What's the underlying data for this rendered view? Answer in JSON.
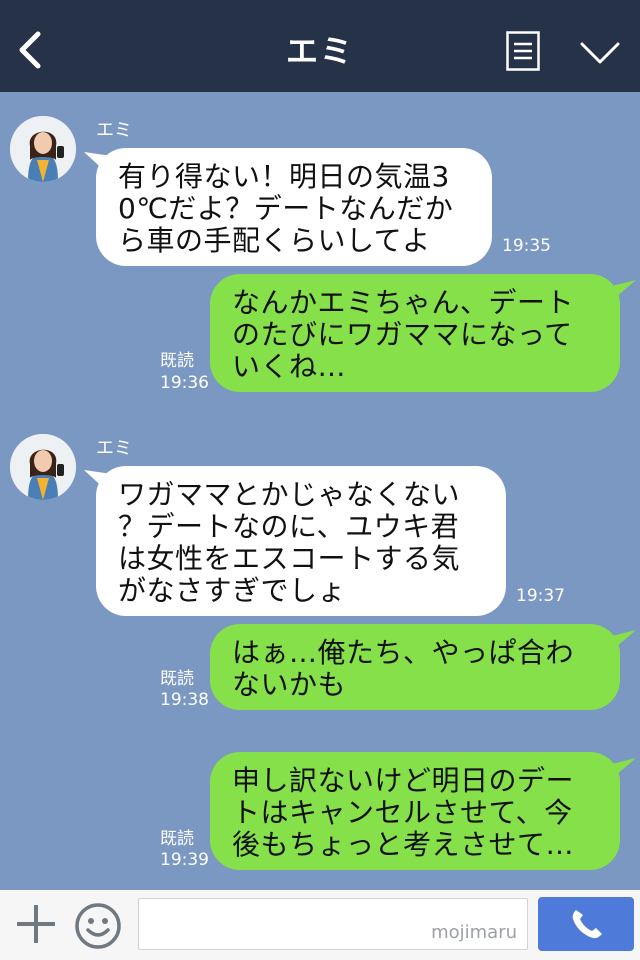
{
  "header": {
    "title": "エミ",
    "back_icon": "chevron-left-icon",
    "menu_icon": "list-icon",
    "dropdown_icon": "chevron-down-icon"
  },
  "messages": [
    {
      "type": "incoming",
      "sender": "エミ",
      "text": "有り得ない！明日の気温3\n0℃だよ？デートなんだか\nら車の手配くらいしてよ",
      "time": "19:35"
    },
    {
      "type": "outgoing",
      "read": "既読",
      "text": "なんかエミちゃん、デート\nのたびにワガママになって\nいくね…",
      "time": "19:36"
    },
    {
      "type": "incoming",
      "sender": "エミ",
      "text": "ワガママとかじゃなくない\n？デートなのに、ユウキ君\nは女性をエスコートする気\nがなさすぎでしょ",
      "time": "19:37"
    },
    {
      "type": "outgoing",
      "read": "既読",
      "text": "はぁ…俺たち、やっぱ合わ\nないかも",
      "time": "19:38"
    },
    {
      "type": "outgoing",
      "read": "既読",
      "text": "申し訳ないけど明日のデー\nトはキャンセルさせて、今\n後もちょっと考えさせて…",
      "time": "19:39"
    }
  ],
  "input_bar": {
    "placeholder": "",
    "watermark": "mojimaru",
    "plus_icon": "plus-icon",
    "emoji_icon": "smiley-icon",
    "call_icon": "phone-icon"
  },
  "colors": {
    "header_bg": "#263248",
    "chat_bg": "#7b98c3",
    "outgoing_bubble": "#86e04a",
    "incoming_bubble": "#ffffff",
    "call_button": "#4e7bda"
  }
}
